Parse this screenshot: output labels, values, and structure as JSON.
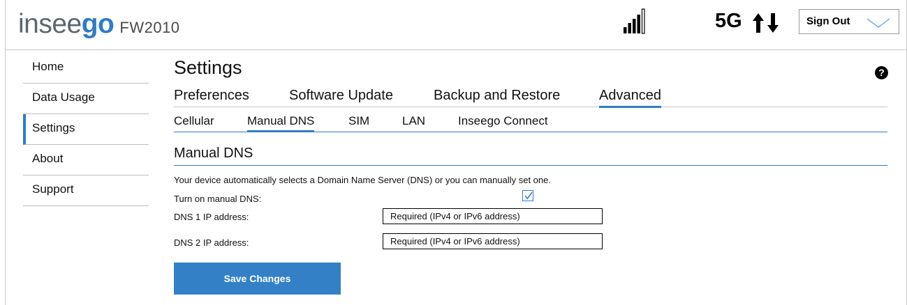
{
  "header": {
    "brand_part1": "insee",
    "brand_part2": "go",
    "model": "FW2010",
    "network": "5G",
    "sign_out_label": "Sign Out"
  },
  "icons": {
    "signal": "signal-bars-icon",
    "data_arrows": "up-down-arrows-icon",
    "dropdown": "chevron-down-icon",
    "help": "question-icon",
    "check": "check-icon"
  },
  "colors": {
    "accent": "#2f7cc7",
    "button": "#3380c7",
    "brand_gray": "#5b6770"
  },
  "sidebar": {
    "items": [
      {
        "label": "Home"
      },
      {
        "label": "Data Usage"
      },
      {
        "label": "Settings"
      },
      {
        "label": "About"
      },
      {
        "label": "Support"
      }
    ],
    "active": "Settings"
  },
  "main": {
    "title": "Settings",
    "help_label": "?",
    "tabs": [
      {
        "label": "Preferences"
      },
      {
        "label": "Software Update"
      },
      {
        "label": "Backup and Restore"
      },
      {
        "label": "Advanced"
      }
    ],
    "active_tab": "Advanced",
    "subtabs": [
      {
        "label": "Cellular"
      },
      {
        "label": "Manual DNS"
      },
      {
        "label": "SIM"
      },
      {
        "label": "LAN"
      },
      {
        "label": "Inseego Connect"
      }
    ],
    "active_subtab": "Manual DNS"
  },
  "dns": {
    "section_title": "Manual DNS",
    "description": "Your device automatically selects a Domain  Name Server (DNS) or you can manually set one.",
    "toggle_label": "Turn on manual DNS:",
    "toggle_checked": true,
    "dns1_label": "DNS 1 IP address:",
    "dns1_placeholder": "Required (IPv4 or IPv6 address)",
    "dns1_value": "",
    "dns2_label": "DNS 2 IP address:",
    "dns2_placeholder": "Required (IPv4 or IPv6 address)",
    "dns2_value": "",
    "save_label": "Save Changes"
  }
}
